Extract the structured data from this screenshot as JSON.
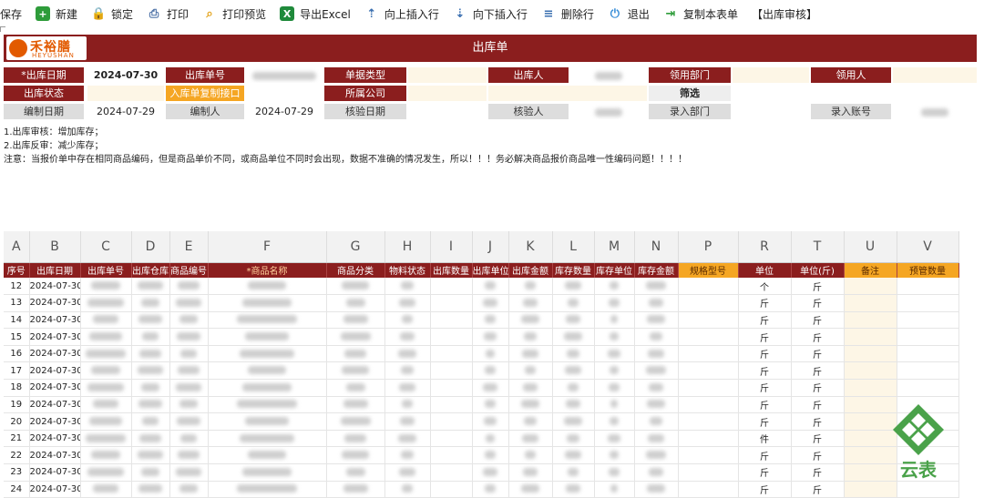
{
  "toolbar": [
    {
      "label": "保存",
      "icon": "save-icon",
      "color": "#333333"
    },
    {
      "label": "新建",
      "icon": "new-icon",
      "color": "#2e9c3a"
    },
    {
      "label": "锁定",
      "icon": "lock-icon",
      "color": "#d8342c"
    },
    {
      "label": "打印",
      "icon": "print-icon",
      "color": "#4a6fa5"
    },
    {
      "label": "打印预览",
      "icon": "print-preview-icon",
      "color": "#e3a21a"
    },
    {
      "label": "导出Excel",
      "icon": "excel-icon",
      "color": "#1f8a3b"
    },
    {
      "label": "向上插入行",
      "icon": "insert-row-up-icon",
      "color": "#3a6fb0"
    },
    {
      "label": "向下插入行",
      "icon": "insert-row-down-icon",
      "color": "#3a6fb0"
    },
    {
      "label": "删除行",
      "icon": "delete-row-icon",
      "color": "#3a6fb0"
    },
    {
      "label": "退出",
      "icon": "power-icon",
      "color": "#3a8fd8"
    },
    {
      "label": "复制本表单",
      "icon": "copy-form-icon",
      "color": "#2e9c3a"
    },
    {
      "label": "【出库审核】",
      "icon": "",
      "color": "#333333"
    }
  ],
  "header": {
    "logo_cn": "禾裕膳",
    "logo_en": "HEYUSHAN",
    "title": "出库单",
    "bar_color": "#8b1e1e"
  },
  "form": {
    "row1": [
      {
        "label": "*出库日期",
        "value": "2024-07-30"
      },
      {
        "label": "出库单号",
        "value": ""
      },
      {
        "label": "单据类型",
        "value": ""
      },
      {
        "label": "出库人",
        "value": ""
      },
      {
        "label": "领用部门",
        "value": ""
      },
      {
        "label": "领用人",
        "value": ""
      }
    ],
    "row2": [
      {
        "label": "出库状态",
        "value": ""
      },
      {
        "label": "入库单复制接口",
        "value": ""
      },
      {
        "label": "所属公司",
        "value": ""
      },
      {
        "label": "筛选",
        "value": ""
      }
    ],
    "row3": [
      {
        "label": "编制日期",
        "value": "2024-07-29"
      },
      {
        "label": "编制人",
        "value": "2024-07-29"
      },
      {
        "label": "核验日期",
        "value": ""
      },
      {
        "label": "核验人",
        "value": ""
      },
      {
        "label": "录入部门",
        "value": ""
      },
      {
        "label": "录入账号",
        "value": ""
      }
    ]
  },
  "notes": [
    "1.出库审核：增加库存；",
    "2.出库反审：减少库存；",
    "注意：当报价单中存在相同商品编码，但是商品单价不同，或商品单位不同时会出现，数据不准确的情况发生，所以！！！务必解决商品报价商品唯一性编码问题！！！！"
  ],
  "sheet": {
    "column_letters": [
      "A",
      "B",
      "C",
      "D",
      "E",
      "F",
      "G",
      "H",
      "I",
      "J",
      "K",
      "L",
      "M",
      "N",
      "P",
      "R",
      "T",
      "U",
      "V"
    ],
    "field_headers": [
      "序号",
      "出库日期",
      "出库单号",
      "出库仓库",
      "商品编号",
      "*商品名称",
      "商品分类",
      "物料状态",
      "出库数量",
      "出库单位",
      "出库金额",
      "库存数量",
      "库存单位",
      "库存金额",
      "规格型号",
      "单位",
      "单位(斤)",
      "备注",
      "预管数量"
    ],
    "rows": [
      {
        "no": "12",
        "date": "2024-07-30",
        "unit": "个",
        "unit_jin": "斤"
      },
      {
        "no": "13",
        "date": "2024-07-30",
        "unit": "斤",
        "unit_jin": "斤"
      },
      {
        "no": "14",
        "date": "2024-07-30",
        "unit": "斤",
        "unit_jin": "斤"
      },
      {
        "no": "15",
        "date": "2024-07-30",
        "unit": "斤",
        "unit_jin": "斤"
      },
      {
        "no": "16",
        "date": "2024-07-30",
        "unit": "斤",
        "unit_jin": "斤"
      },
      {
        "no": "17",
        "date": "2024-07-30",
        "unit": "斤",
        "unit_jin": "斤"
      },
      {
        "no": "18",
        "date": "2024-07-30",
        "unit": "斤",
        "unit_jin": "斤"
      },
      {
        "no": "19",
        "date": "2024-07-30",
        "unit": "斤",
        "unit_jin": "斤"
      },
      {
        "no": "20",
        "date": "2024-07-30",
        "unit": "斤",
        "unit_jin": "斤"
      },
      {
        "no": "21",
        "date": "2024-07-30",
        "unit": "件",
        "unit_jin": "斤"
      },
      {
        "no": "22",
        "date": "2024-07-30",
        "unit": "斤",
        "unit_jin": "斤"
      },
      {
        "no": "23",
        "date": "2024-07-30",
        "unit": "斤",
        "unit_jin": "斤"
      },
      {
        "no": "24",
        "date": "2024-07-30",
        "unit": "斤",
        "unit_jin": "斤"
      }
    ]
  },
  "watermark": {
    "text": "云表",
    "color": "#4aa24a"
  }
}
